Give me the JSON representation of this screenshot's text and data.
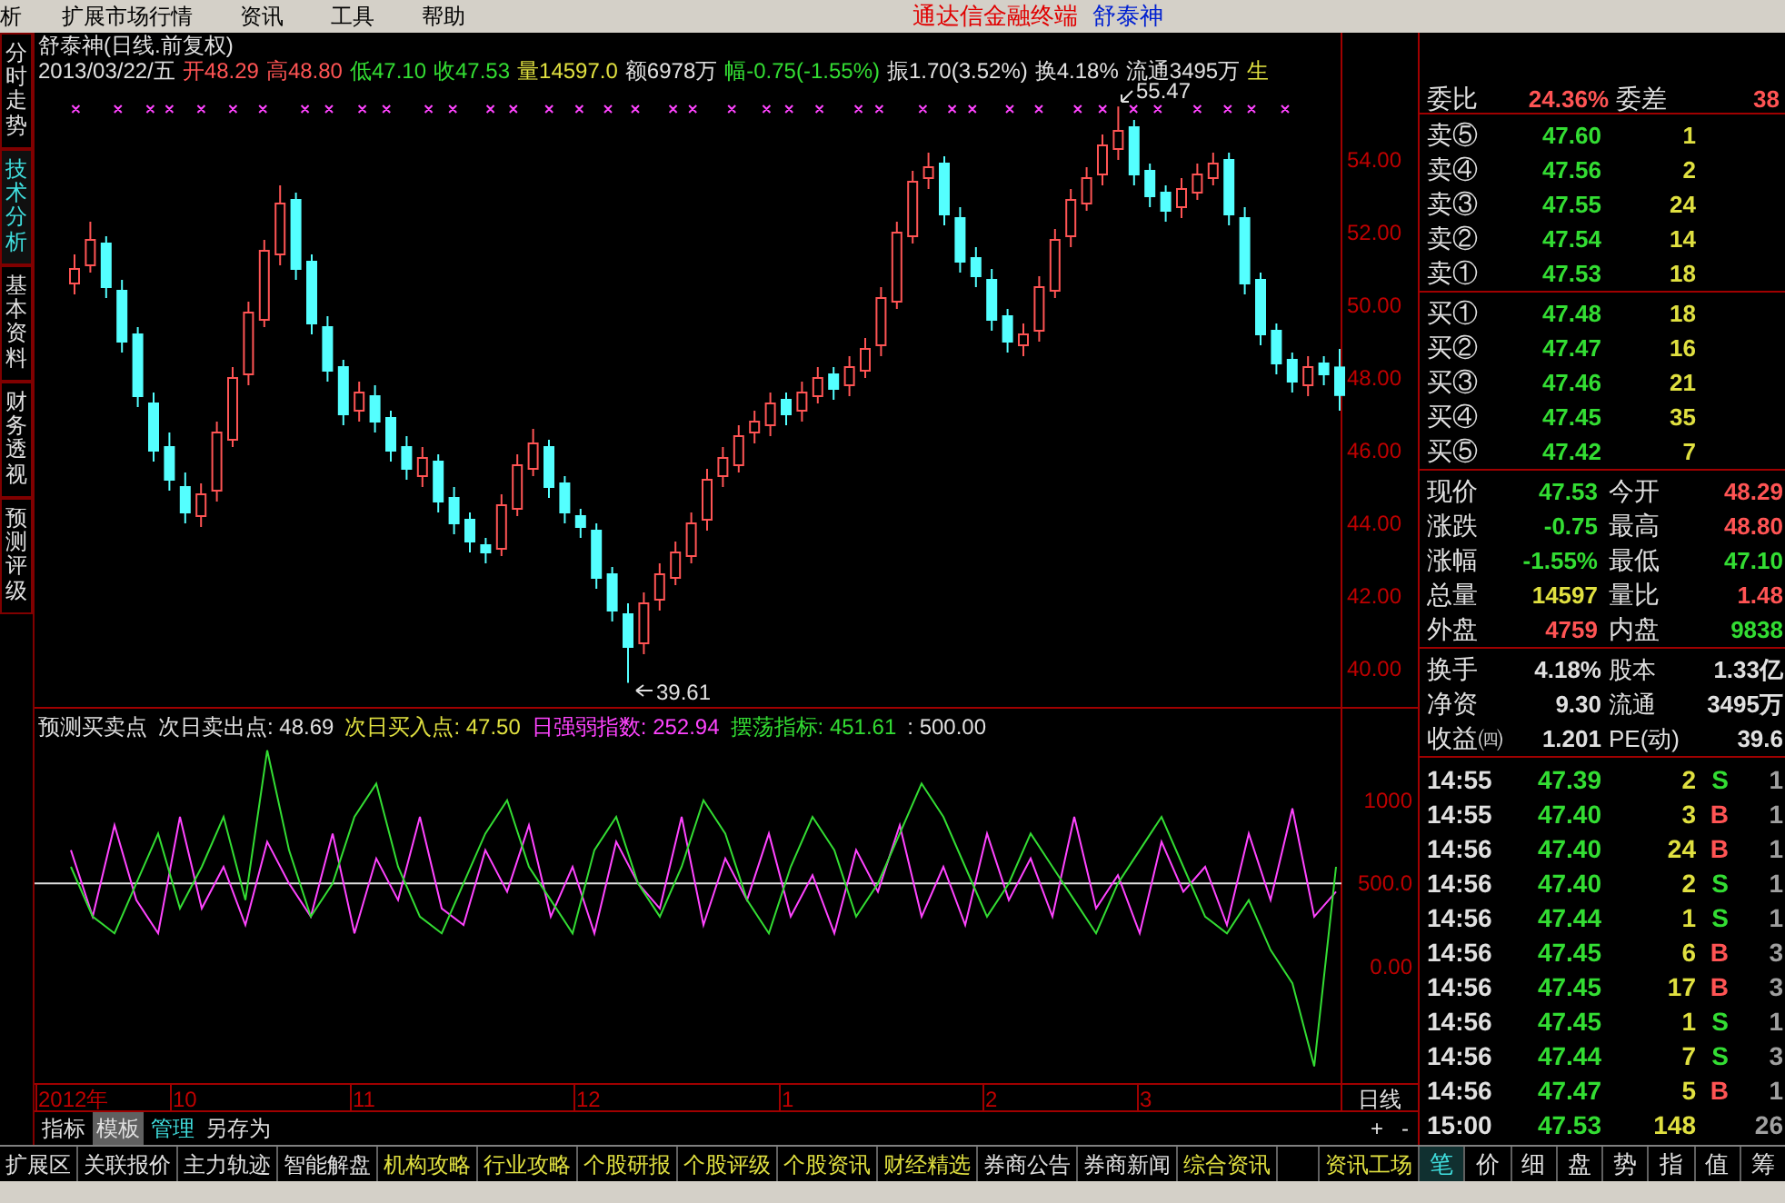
{
  "menu": {
    "items": [
      "析",
      "扩展市场行情",
      "资讯",
      "工具",
      "帮助"
    ],
    "app_name": "通达信金融终端",
    "stock_name": "舒泰神"
  },
  "side_tabs": [
    {
      "label": "分时走势",
      "selected": false
    },
    {
      "label": "技术分析",
      "selected": true
    },
    {
      "label": "基本资料",
      "selected": false
    },
    {
      "label": "财务透视",
      "selected": false
    },
    {
      "label": "预测评级",
      "selected": false
    }
  ],
  "chart": {
    "title": "舒泰神(日线.前复权)",
    "info": [
      {
        "text": "2013/03/22/五",
        "kind": "neutral"
      },
      {
        "text": "开48.29",
        "kind": "up"
      },
      {
        "text": "高48.80",
        "kind": "up"
      },
      {
        "text": "低47.10",
        "kind": "down"
      },
      {
        "text": "收47.53",
        "kind": "down"
      },
      {
        "text": "量14597.0",
        "kind": "volume"
      },
      {
        "text": "额6978万",
        "kind": "neutral"
      },
      {
        "text": "幅-0.75(-1.55%)",
        "kind": "down"
      },
      {
        "text": "振1.70(3.52%)",
        "kind": "neutral"
      },
      {
        "text": "换4.18%",
        "kind": "neutral"
      },
      {
        "text": "流通3495万",
        "kind": "neutral"
      },
      {
        "text": "生",
        "kind": "volume"
      }
    ],
    "chart_data": {
      "type": "candlestick",
      "ylim": [
        38.9,
        57.5
      ],
      "yticks": [
        {
          "value": 54,
          "label": "54.00"
        },
        {
          "value": 52,
          "label": "52.00"
        },
        {
          "value": 50,
          "label": "50.00"
        },
        {
          "value": 48,
          "label": "48.00"
        },
        {
          "value": 46,
          "label": "46.00"
        },
        {
          "value": 44,
          "label": "44.00"
        },
        {
          "value": 42,
          "label": "42.00"
        },
        {
          "value": 40,
          "label": "40.00"
        }
      ],
      "ohlc": [
        [
          50.6,
          51.4,
          50.3,
          51.0
        ],
        [
          51.1,
          52.3,
          50.9,
          51.8
        ],
        [
          51.7,
          51.9,
          50.2,
          50.5
        ],
        [
          50.4,
          50.7,
          48.7,
          49.0
        ],
        [
          49.2,
          49.4,
          47.2,
          47.5
        ],
        [
          47.3,
          47.6,
          45.7,
          46.0
        ],
        [
          46.1,
          46.5,
          44.9,
          45.2
        ],
        [
          45.0,
          45.4,
          44.0,
          44.3
        ],
        [
          44.2,
          45.1,
          43.9,
          44.8
        ],
        [
          44.9,
          46.8,
          44.6,
          46.5
        ],
        [
          46.3,
          48.3,
          46.1,
          48.0
        ],
        [
          48.1,
          50.1,
          47.8,
          49.8
        ],
        [
          49.6,
          51.8,
          49.4,
          51.5
        ],
        [
          51.4,
          53.3,
          51.1,
          52.8
        ],
        [
          52.9,
          53.1,
          50.7,
          51.0
        ],
        [
          51.2,
          51.4,
          49.2,
          49.5
        ],
        [
          49.4,
          49.7,
          47.9,
          48.2
        ],
        [
          48.3,
          48.5,
          46.7,
          47.0
        ],
        [
          47.1,
          47.9,
          46.8,
          47.6
        ],
        [
          47.5,
          47.8,
          46.5,
          46.8
        ],
        [
          46.9,
          47.1,
          45.7,
          46.0
        ],
        [
          46.1,
          46.4,
          45.2,
          45.5
        ],
        [
          45.3,
          46.1,
          45.0,
          45.8
        ],
        [
          45.7,
          45.9,
          44.3,
          44.6
        ],
        [
          44.7,
          45.0,
          43.7,
          44.0
        ],
        [
          44.1,
          44.3,
          43.2,
          43.5
        ],
        [
          43.4,
          43.6,
          42.9,
          43.2
        ],
        [
          43.3,
          44.8,
          43.1,
          44.5
        ],
        [
          44.4,
          45.9,
          44.2,
          45.6
        ],
        [
          45.5,
          46.6,
          45.3,
          46.2
        ],
        [
          46.1,
          46.3,
          44.7,
          45.0
        ],
        [
          45.1,
          45.3,
          44.0,
          44.3
        ],
        [
          44.2,
          44.4,
          43.6,
          43.9
        ],
        [
          43.8,
          44.0,
          42.2,
          42.5
        ],
        [
          42.6,
          42.8,
          41.3,
          41.6
        ],
        [
          41.5,
          41.8,
          39.61,
          40.6
        ],
        [
          40.7,
          42.1,
          40.4,
          41.8
        ],
        [
          41.9,
          42.9,
          41.6,
          42.6
        ],
        [
          42.5,
          43.5,
          42.3,
          43.2
        ],
        [
          43.1,
          44.3,
          42.9,
          44.0
        ],
        [
          44.1,
          45.5,
          43.8,
          45.2
        ],
        [
          45.3,
          46.1,
          45.0,
          45.8
        ],
        [
          45.6,
          46.7,
          45.4,
          46.4
        ],
        [
          46.5,
          47.1,
          46.2,
          46.8
        ],
        [
          46.7,
          47.6,
          46.4,
          47.3
        ],
        [
          47.4,
          47.6,
          46.7,
          47.0
        ],
        [
          47.1,
          47.9,
          46.8,
          47.6
        ],
        [
          47.5,
          48.3,
          47.3,
          48.0
        ],
        [
          48.1,
          48.3,
          47.4,
          47.7
        ],
        [
          47.8,
          48.6,
          47.5,
          48.3
        ],
        [
          48.2,
          49.1,
          48.0,
          48.8
        ],
        [
          48.9,
          50.5,
          48.6,
          50.2
        ],
        [
          50.1,
          52.3,
          49.9,
          52.0
        ],
        [
          51.9,
          53.7,
          51.7,
          53.4
        ],
        [
          53.5,
          54.2,
          53.2,
          53.8
        ],
        [
          53.9,
          54.1,
          52.2,
          52.5
        ],
        [
          52.4,
          52.7,
          50.9,
          51.2
        ],
        [
          51.3,
          51.6,
          50.5,
          50.8
        ],
        [
          50.7,
          51.0,
          49.3,
          49.6
        ],
        [
          49.7,
          49.9,
          48.7,
          49.0
        ],
        [
          48.9,
          49.5,
          48.6,
          49.2
        ],
        [
          49.3,
          50.8,
          49.0,
          50.5
        ],
        [
          50.4,
          52.1,
          50.2,
          51.8
        ],
        [
          51.9,
          53.2,
          51.6,
          52.9
        ],
        [
          52.8,
          53.8,
          52.6,
          53.5
        ],
        [
          53.6,
          54.7,
          53.3,
          54.4
        ],
        [
          54.3,
          55.47,
          54.0,
          54.8
        ],
        [
          54.9,
          55.1,
          53.3,
          53.6
        ],
        [
          53.7,
          53.9,
          52.7,
          53.0
        ],
        [
          53.1,
          53.3,
          52.3,
          52.6
        ],
        [
          52.7,
          53.5,
          52.4,
          53.2
        ],
        [
          53.1,
          53.9,
          52.9,
          53.6
        ],
        [
          53.5,
          54.2,
          53.3,
          53.9
        ],
        [
          54.0,
          54.2,
          52.2,
          52.5
        ],
        [
          52.4,
          52.7,
          50.3,
          50.6
        ],
        [
          50.7,
          50.9,
          48.9,
          49.2
        ],
        [
          49.3,
          49.5,
          48.1,
          48.4
        ],
        [
          48.5,
          48.7,
          47.6,
          47.9
        ],
        [
          47.8,
          48.6,
          47.5,
          48.3
        ],
        [
          48.4,
          48.6,
          47.8,
          48.1
        ],
        [
          48.29,
          48.8,
          47.1,
          47.53
        ]
      ]
    },
    "high_label": "55.47",
    "low_label": "39.61"
  },
  "indicator": {
    "name": "预测买卖点",
    "items": [
      {
        "text": "次日卖出点: 48.69",
        "kind": "neutral"
      },
      {
        "text": "次日买入点: 47.50",
        "kind": "volume"
      },
      {
        "text": "日强弱指数: 252.94",
        "kind": "magenta"
      },
      {
        "text": "摆荡指标: 451.61",
        "kind": "down"
      },
      {
        "text": ": 500.00",
        "kind": "neutral"
      }
    ],
    "chart_data": {
      "type": "line",
      "ylim": [
        -700,
        1550
      ],
      "yticks": [
        {
          "value": 1000,
          "label": "1000"
        },
        {
          "value": 500,
          "label": "500.0"
        },
        {
          "value": 0,
          "label": "0.00"
        }
      ],
      "series": [
        {
          "color": "#ff44ff",
          "values": [
            700,
            300,
            850,
            400,
            200,
            900,
            350,
            600,
            250,
            750,
            500,
            300,
            800,
            200,
            650,
            400,
            900,
            350,
            250,
            700,
            450,
            850,
            300,
            600,
            200,
            750,
            500,
            350,
            900,
            250,
            650,
            400,
            800,
            300,
            550,
            200,
            700,
            450,
            850,
            300,
            600,
            250,
            800,
            400,
            650,
            300,
            900,
            350,
            550,
            200,
            750,
            450,
            600,
            250,
            800,
            400,
            950,
            300,
            450
          ]
        },
        {
          "color": "#33dd33",
          "values": [
            600,
            300,
            200,
            500,
            800,
            350,
            600,
            900,
            400,
            1300,
            700,
            300,
            500,
            900,
            1100,
            600,
            300,
            200,
            500,
            800,
            1000,
            600,
            400,
            200,
            700,
            900,
            500,
            300,
            600,
            1000,
            800,
            400,
            200,
            600,
            900,
            700,
            300,
            500,
            800,
            1100,
            900,
            600,
            300,
            500,
            800,
            600,
            400,
            200,
            500,
            700,
            900,
            600,
            300,
            200,
            400,
            100,
            -100,
            -600,
            600
          ]
        }
      ]
    }
  },
  "date_axis": {
    "labels": [
      "2012年",
      "10",
      "11",
      "12",
      "1",
      "2",
      "3"
    ],
    "period": "日线"
  },
  "template_tabs": [
    {
      "label": "指标",
      "selected": false,
      "kind": "normal"
    },
    {
      "label": "模板",
      "selected": true,
      "kind": "normal"
    },
    {
      "label": "管理",
      "selected": false,
      "kind": "link"
    },
    {
      "label": "另存为",
      "selected": false,
      "kind": "normal"
    }
  ],
  "zoom_buttons": [
    "+",
    "-"
  ],
  "bottom_tabs": [
    {
      "label": "扩展区",
      "kind": "normal"
    },
    {
      "label": "关联报价",
      "kind": "normal"
    },
    {
      "label": "主力轨迹",
      "kind": "normal"
    },
    {
      "label": "智能解盘",
      "kind": "normal"
    },
    {
      "label": "机构攻略",
      "kind": "highlight"
    },
    {
      "label": "行业攻略",
      "kind": "highlight"
    },
    {
      "label": "个股研报",
      "kind": "highlight"
    },
    {
      "label": "个股评级",
      "kind": "highlight"
    },
    {
      "label": "个股资讯",
      "kind": "highlight"
    },
    {
      "label": "财经精选",
      "kind": "highlight"
    },
    {
      "label": "券商公告",
      "kind": "normal"
    },
    {
      "label": "券商新闻",
      "kind": "normal"
    },
    {
      "label": "综合资讯",
      "kind": "highlight"
    }
  ],
  "right_tab": {
    "label": "资讯工场",
    "kind": "highlight"
  },
  "quote": {
    "order_ratio": {
      "label": "委比",
      "value": "24.36%",
      "diff_label": "委差",
      "diff_value": "38"
    },
    "asks": [
      {
        "label": "卖⑤",
        "price": "47.60",
        "volume": "1"
      },
      {
        "label": "卖④",
        "price": "47.56",
        "volume": "2"
      },
      {
        "label": "卖③",
        "price": "47.55",
        "volume": "24"
      },
      {
        "label": "卖②",
        "price": "47.54",
        "volume": "14"
      },
      {
        "label": "卖①",
        "price": "47.53",
        "volume": "18"
      }
    ],
    "bids": [
      {
        "label": "买①",
        "price": "47.48",
        "volume": "18"
      },
      {
        "label": "买②",
        "price": "47.47",
        "volume": "16"
      },
      {
        "label": "买③",
        "price": "47.46",
        "volume": "21"
      },
      {
        "label": "买④",
        "price": "47.45",
        "volume": "35"
      },
      {
        "label": "买⑤",
        "price": "47.42",
        "volume": "7"
      }
    ],
    "stats": [
      {
        "cells": [
          {
            "label": "现价",
            "value": "47.53",
            "kind": "down"
          },
          {
            "label": "今开",
            "value": "48.29",
            "kind": "up"
          }
        ]
      },
      {
        "cells": [
          {
            "label": "涨跌",
            "value": "-0.75",
            "kind": "down"
          },
          {
            "label": "最高",
            "value": "48.80",
            "kind": "up"
          }
        ]
      },
      {
        "cells": [
          {
            "label": "涨幅",
            "value": "-1.55%",
            "kind": "down"
          },
          {
            "label": "最低",
            "value": "47.10",
            "kind": "down"
          }
        ]
      },
      {
        "cells": [
          {
            "label": "总量",
            "value": "14597",
            "kind": "volume"
          },
          {
            "label": "量比",
            "value": "1.48",
            "kind": "up"
          }
        ]
      },
      {
        "cells": [
          {
            "label": "外盘",
            "value": "4759",
            "kind": "up"
          },
          {
            "label": "内盘",
            "value": "9838",
            "kind": "down"
          }
        ]
      }
    ],
    "fundamentals": [
      {
        "label": "换手",
        "value": "4.18%",
        "label2": "股本",
        "value2": "1.33亿"
      },
      {
        "label": "净资",
        "value": "9.30",
        "label2": "流通",
        "value2": "3495万"
      },
      {
        "label": "收益㈣",
        "value": "1.201",
        "label2": "PE(动)",
        "value2": "39.6"
      }
    ],
    "ticks": [
      {
        "time": "14:55",
        "price": "47.39",
        "volume": "2",
        "side": "S",
        "extra": "1"
      },
      {
        "time": "14:55",
        "price": "47.40",
        "volume": "3",
        "side": "B",
        "extra": "1"
      },
      {
        "time": "14:56",
        "price": "47.40",
        "volume": "24",
        "side": "B",
        "extra": "1"
      },
      {
        "time": "14:56",
        "price": "47.40",
        "volume": "2",
        "side": "S",
        "extra": "1"
      },
      {
        "time": "14:56",
        "price": "47.44",
        "volume": "1",
        "side": "S",
        "extra": "1"
      },
      {
        "time": "14:56",
        "price": "47.45",
        "volume": "6",
        "side": "B",
        "extra": "3"
      },
      {
        "time": "14:56",
        "price": "47.45",
        "volume": "17",
        "side": "B",
        "extra": "3"
      },
      {
        "time": "14:56",
        "price": "47.45",
        "volume": "1",
        "side": "S",
        "extra": "1"
      },
      {
        "time": "14:56",
        "price": "47.44",
        "volume": "7",
        "side": "S",
        "extra": "3"
      },
      {
        "time": "14:56",
        "price": "47.47",
        "volume": "5",
        "side": "B",
        "extra": "1"
      },
      {
        "time": "15:00",
        "price": "47.53",
        "volume": "148",
        "extra": "26"
      }
    ],
    "tabs": [
      {
        "label": "笔",
        "selected": true
      },
      {
        "label": "价",
        "selected": false
      },
      {
        "label": "细",
        "selected": false
      },
      {
        "label": "盘",
        "selected": false
      },
      {
        "label": "势",
        "selected": false
      },
      {
        "label": "指",
        "selected": false
      },
      {
        "label": "值",
        "selected": false
      },
      {
        "label": "筹",
        "selected": false
      }
    ]
  }
}
